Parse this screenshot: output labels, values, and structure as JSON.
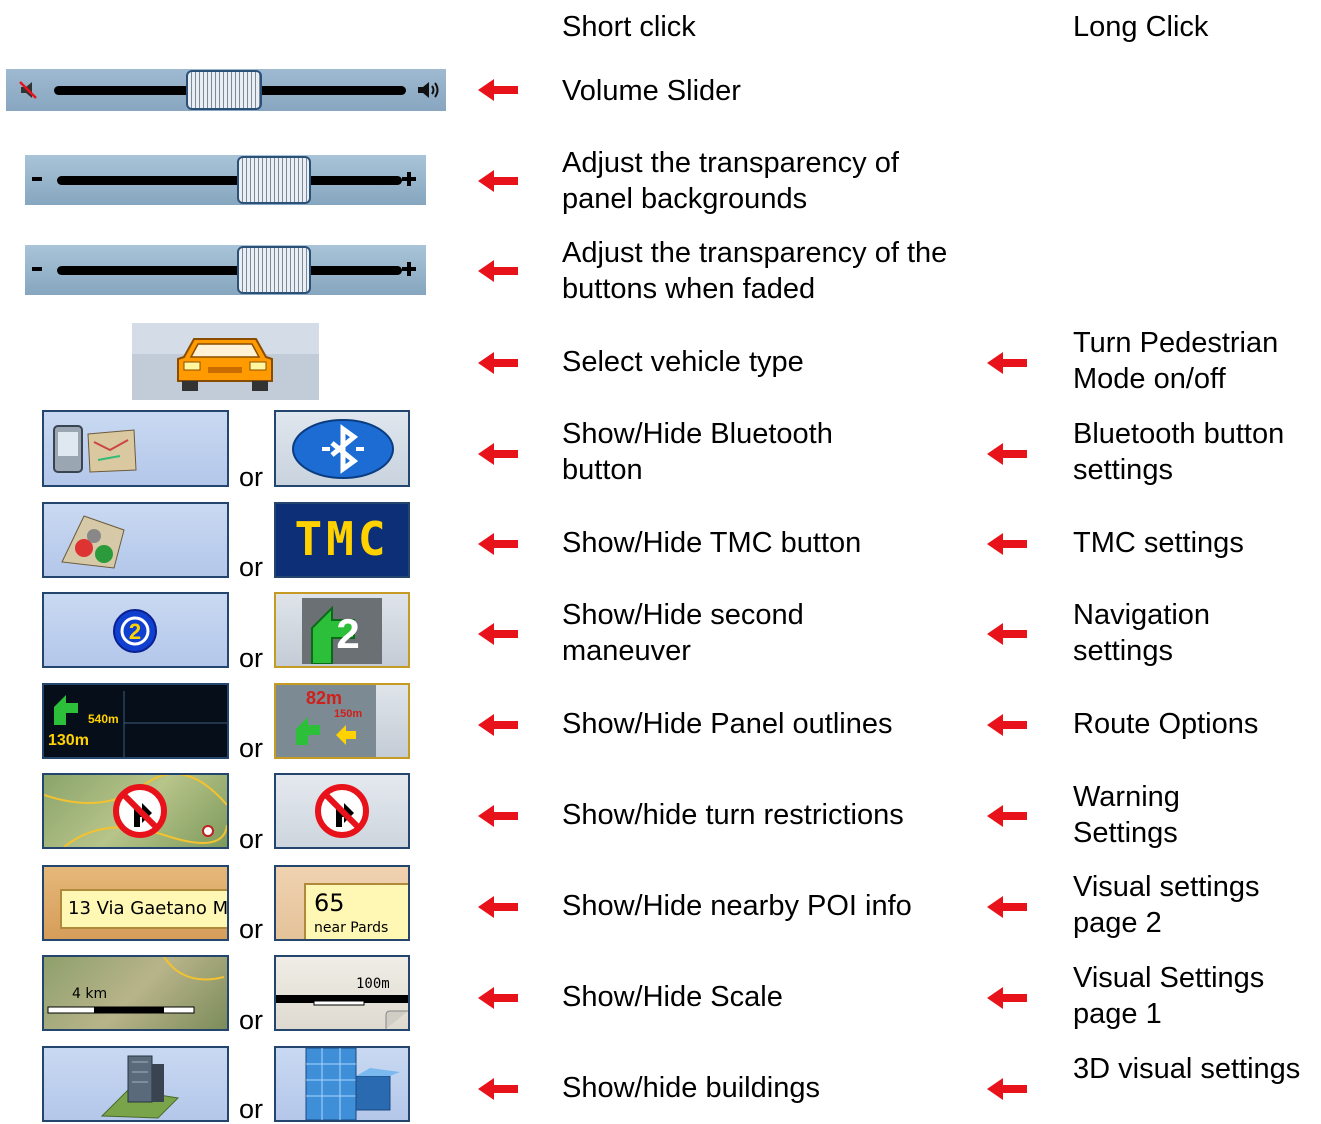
{
  "headers": {
    "short_click": "Short click",
    "long_click": "Long Click"
  },
  "colors": {
    "arrow": "#e8121b",
    "button_border": "#24456e",
    "button_gold_border": "#c69b23",
    "slider_bg": "#94b2c8",
    "car": "#ff9b00"
  },
  "rows": [
    {
      "short": "Volume Slider",
      "long": ""
    },
    {
      "short": "Adjust the transparency of panel backgrounds",
      "long": ""
    },
    {
      "short": "Adjust the transparency of the buttons when faded",
      "long": ""
    },
    {
      "short": "Select vehicle type",
      "long": "Turn Pedestrian Mode on/off"
    },
    {
      "short": "Show/Hide Bluetooth button",
      "long": "Bluetooth button settings",
      "or": "or"
    },
    {
      "short": "Show/Hide TMC button",
      "long": "TMC settings",
      "or": "or"
    },
    {
      "short": "Show/Hide second maneuver",
      "long": "Navigation settings",
      "or": "or"
    },
    {
      "short": "Show/Hide Panel outlines",
      "long": "Route Options",
      "or": "or"
    },
    {
      "short": "Show/hide turn restrictions",
      "long": "Warning Settings",
      "or": "or"
    },
    {
      "short": "Show/Hide nearby POI info",
      "long": "Visual settings page 2",
      "or": "or"
    },
    {
      "short": "Show/Hide Scale",
      "long": "Visual Settings page 1",
      "or": "or"
    },
    {
      "short": "Show/hide buildings",
      "long": "3D visual settings",
      "or": "or"
    }
  ],
  "icon_texts": {
    "tmc": "TMC",
    "maneuver_num": "2",
    "panel_dist_1": "540m",
    "panel_dist_2": "130m",
    "panel_dist_3": "82m",
    "panel_dist_4": "150m",
    "poi_street": "13 Via Gaetano M",
    "poi_speed": "65",
    "poi_near": "near Pards",
    "scale_km": "4 km",
    "scale_m": "100m"
  }
}
